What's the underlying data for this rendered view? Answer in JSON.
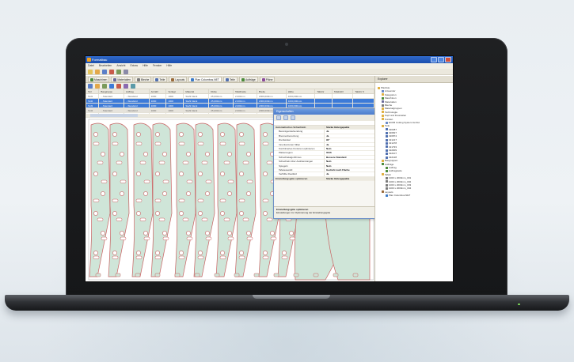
{
  "window": {
    "title": "Formatbau",
    "menu": [
      "Datei",
      "Bearbeiten",
      "Ansicht",
      "Extras",
      "Hilfe",
      "Fenster",
      "Hilfe"
    ]
  },
  "tabs": [
    {
      "label": "Maschinen",
      "color": "#4a8a3a"
    },
    {
      "label": "Materialien",
      "color": "#6a6a9a"
    },
    {
      "label": "Bleche",
      "color": "#7a7a7a"
    },
    {
      "label": "Teile",
      "color": "#4f6fb0"
    },
    {
      "label": "Layouts",
      "color": "#9a6a3a"
    },
    {
      "label": "Plan Columbus.NET",
      "color": "#3a7ac8",
      "active": true
    },
    {
      "label": "Teile",
      "color": "#4f6fb0"
    },
    {
      "label": "Aufträge",
      "color": "#4a8a3a"
    },
    {
      "label": "Pläne",
      "color": "#8a4a9a"
    }
  ],
  "explorer": {
    "title": "Explorer",
    "items": [
      {
        "label": "Planliste",
        "indent": 0,
        "color": "#e0b040"
      },
      {
        "label": "Anwender",
        "indent": 1,
        "color": "#6a8ac8"
      },
      {
        "label": "Kategorien",
        "indent": 1,
        "color": "#e0b040"
      },
      {
        "label": "Maschinen",
        "indent": 1,
        "color": "#4a8a3a"
      },
      {
        "label": "Materialien",
        "indent": 1,
        "color": "#6a6a9a"
      },
      {
        "label": "Bleche",
        "indent": 1,
        "color": "#7a7a7a"
      },
      {
        "label": "Materialgruppen",
        "indent": 1,
        "color": "#e0b040"
      },
      {
        "label": "Technologie",
        "indent": 1,
        "color": "#e0b040"
      },
      {
        "label": "Kopf und Fusszeilen",
        "indent": 1,
        "color": "#e0b040"
      },
      {
        "label": "Kunden",
        "indent": 1,
        "color": "#e0b040"
      },
      {
        "label": "ECKB Cutting System GmbH",
        "indent": 2,
        "color": "#6a8ac8"
      },
      {
        "label": "Teile",
        "indent": 1,
        "color": "#e0b040"
      },
      {
        "label": "320387",
        "indent": 2,
        "color": "#4f6fb0"
      },
      {
        "label": "320827",
        "indent": 2,
        "color": "#4f6fb0"
      },
      {
        "label": "320874",
        "indent": 2,
        "color": "#4f6fb0"
      },
      {
        "label": "321217",
        "indent": 2,
        "color": "#4f6fb0"
      },
      {
        "label": "321278",
        "indent": 2,
        "color": "#4f6fb0"
      },
      {
        "label": "321793",
        "indent": 2,
        "color": "#4f6fb0"
      },
      {
        "label": "322009",
        "indent": 2,
        "color": "#4f6fb0"
      },
      {
        "label": "322107",
        "indent": 2,
        "color": "#4f6fb0"
      },
      {
        "label": "322128",
        "indent": 2,
        "color": "#4f6fb0"
      },
      {
        "label": "Baugruppen",
        "indent": 1,
        "color": "#e0b040"
      },
      {
        "label": "Aufträge",
        "indent": 1,
        "color": "#4a8a3a"
      },
      {
        "label": "Auftrag",
        "indent": 2,
        "color": "#4a8a3a"
      },
      {
        "label": "Auftragsteile",
        "indent": 2,
        "color": "#4a8a3a"
      },
      {
        "label": "Tafeln",
        "indent": 1,
        "color": "#e0b040"
      },
      {
        "label": "1000 x 2000mm_001",
        "indent": 2,
        "color": "#7a7a7a"
      },
      {
        "label": "1000 x 2000mm_002",
        "indent": 2,
        "color": "#7a7a7a"
      },
      {
        "label": "1000 x 2000mm_003",
        "indent": 2,
        "color": "#7a7a7a"
      },
      {
        "label": "1000 x 2000mm_004",
        "indent": 2,
        "color": "#7a7a7a"
      },
      {
        "label": "Layouts",
        "indent": 1,
        "color": "#9a6a3a"
      },
      {
        "label": "Plan Columbus.NET",
        "indent": 2,
        "color": "#3a7ac8"
      }
    ]
  },
  "table": {
    "headers": [
      "Teil",
      "Baugruppe",
      "Auftrag",
      "Anzahl",
      "Verlegt",
      "Material",
      "Dicke",
      "Tafelbreite",
      "Breite",
      "Höhe",
      "Tafelnr",
      "Tafelzahl",
      "Tafelnr K"
    ],
    "rows": [
      {
        "cells": [
          "Teil1",
          "...Standard",
          "...Standard",
          "1000",
          "1000",
          "Stahl blank",
          "25,000mm",
          "2.000mm",
          "2000,000mm",
          "1000,000mm",
          "",
          "",
          ""
        ],
        "style": "normal"
      },
      {
        "cells": [
          "Teil2",
          "...Standard",
          "...Standard",
          "1000",
          "1000",
          "Stahl blank",
          "25,000mm",
          "2.000mm",
          "2000,000mm",
          "1000,000mm",
          "",
          "",
          ""
        ],
        "style": "sel"
      },
      {
        "cells": [
          "Teil3",
          "...Standard",
          "...Standard",
          "1000",
          "1000",
          "Stahl blank",
          "25,000mm",
          "2.000mm",
          "2000,000mm",
          "1000,000mm",
          "",
          "",
          ""
        ],
        "style": "sel"
      },
      {
        "cells": [
          "Teil4",
          "...Standard",
          "...Standard",
          "1000",
          "1000",
          "Stahl blank",
          "25,000mm",
          "2.000mm",
          "2000,000mm",
          "1000,000mm",
          "",
          "",
          ""
        ],
        "style": "alt"
      },
      {
        "cells": [
          "Teil5",
          "...Standard",
          "...Standard",
          "1000",
          "1000",
          "Stahl blank",
          "25,000mm",
          "2.000mm",
          "2000,000mm",
          "1000,000mm",
          "",
          "",
          ""
        ],
        "style": "normal"
      }
    ]
  },
  "properties": {
    "title": "Eigenschaften",
    "rows": [
      {
        "k": "Automatisches Schachteln",
        "v": "Starke Gütergepakte",
        "cat": true
      },
      {
        "k": "Bereinigenderkendung",
        "v": "Ja"
      },
      {
        "k": "Brennenbenutzung",
        "v": "Ja"
      },
      {
        "k": "Drehwinkel",
        "v": "90°"
      },
      {
        "k": "Innenkonturen füllen",
        "v": "Ja"
      },
      {
        "k": "Kombiniertes Konturen optimieren",
        "v": "Nein"
      },
      {
        "k": "Plattenregion",
        "v": "0016"
      },
      {
        "k": "Schachtelalgorithmus",
        "v": "Bessere Standard"
      },
      {
        "k": "Schachteln über Ausblendungen",
        "v": "Nein"
      },
      {
        "k": "Spiegeln",
        "v": "Nein"
      },
      {
        "k": "Tafelauswahl",
        "v": "Gedreht nach Fläche"
      },
      {
        "k": "Verfüllte Restfeld",
        "v": "Ja"
      },
      {
        "k": "Einstellungsgüte optimieren",
        "v": "Starke Gütergepakte",
        "cat": true
      }
    ],
    "desc_title": "Einstellungsgüte optimieren",
    "desc_text": "Einstellungen zur Optimierung der Einstellungsgüte"
  },
  "colors": {
    "part_fill": "#cfe5d8",
    "part_stroke": "#c86060",
    "selection": "#3c7ad8"
  }
}
